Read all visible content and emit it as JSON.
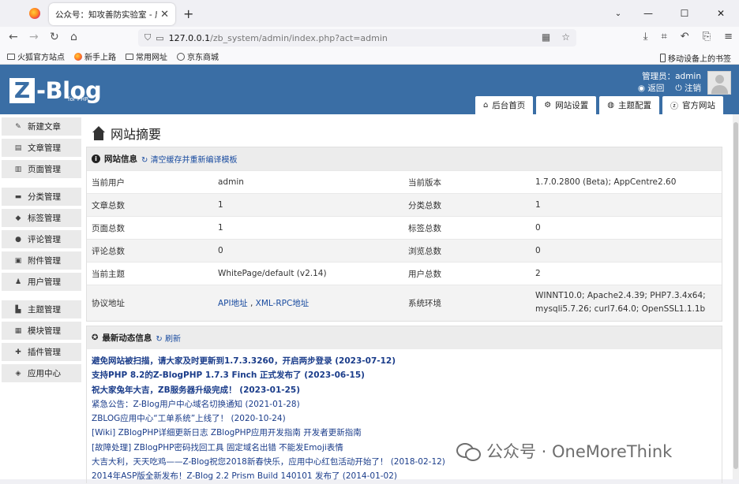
{
  "browser": {
    "tab_title": "公众号：知攻善防实验室 - 后台首页",
    "url_host": "127.0.0.1",
    "url_path": "/zb_system/admin/index.php?act=admin",
    "bookmarks": [
      "火狐官方站点",
      "新手上路",
      "常用网址",
      "京东商城"
    ],
    "mobile_bookmark": "移动设备上的书签"
  },
  "header": {
    "logo_letter": "Z",
    "logo_text": "-Blog",
    "logo_sub": "for PHP",
    "admin_label": "管理员：admin",
    "back_label": "返回",
    "logout_label": "注销",
    "tabs": [
      {
        "label": "后台首页",
        "icon": "home-icon"
      },
      {
        "label": "网站设置",
        "icon": "gear-icon"
      },
      {
        "label": "主题配置",
        "icon": "theme-icon"
      },
      {
        "label": "官方网站",
        "icon": "zblog-icon"
      }
    ]
  },
  "sidebar": {
    "items": [
      {
        "label": "新建文章",
        "icon": "edit-icon"
      },
      {
        "label": "文章管理",
        "icon": "article-icon"
      },
      {
        "label": "页面管理",
        "icon": "page-icon"
      },
      {
        "label": "分类管理",
        "icon": "folder-icon"
      },
      {
        "label": "标签管理",
        "icon": "tag-icon"
      },
      {
        "label": "评论管理",
        "icon": "comment-icon"
      },
      {
        "label": "附件管理",
        "icon": "attachment-icon"
      },
      {
        "label": "用户管理",
        "icon": "users-icon"
      },
      {
        "label": "主题管理",
        "icon": "theme-icon"
      },
      {
        "label": "模块管理",
        "icon": "module-icon"
      },
      {
        "label": "插件管理",
        "icon": "plugin-icon"
      },
      {
        "label": "应用中心",
        "icon": "app-center-icon"
      }
    ]
  },
  "main": {
    "title": "网站摘要",
    "site_info": {
      "heading": "网站信息",
      "clear_cache_link": "清空缓存并重新编译模板",
      "rows": [
        [
          "当前用户",
          "admin",
          "当前版本",
          "1.7.0.2800 (Beta); AppCentre2.60"
        ],
        [
          "文章总数",
          "1",
          "分类总数",
          "1"
        ],
        [
          "页面总数",
          "1",
          "标签总数",
          "0"
        ],
        [
          "评论总数",
          "0",
          "浏览总数",
          "0"
        ],
        [
          "当前主题",
          "WhitePage/default (v2.14)",
          "用户总数",
          "2"
        ]
      ],
      "protocol_label": "协议地址",
      "protocol_api": "API地址",
      "protocol_sep": " , ",
      "protocol_xmlrpc": "XML-RPC地址",
      "env_label": "系统环境",
      "env_line1": "WINNT10.0; Apache2.4.39; PHP7.3.4x64;",
      "env_line2": "mysqli5.7.26; curl7.64.0; OpenSSL1.1.1b"
    },
    "news": {
      "heading": "最新动态信息",
      "refresh_link": "刷新",
      "items": [
        {
          "text": "避免网站被扫描，请大家及时更新到1.7.3.3260，开启两步登录 (2023-07-12)",
          "style": "b"
        },
        {
          "text": "支持PHP 8.2的Z-BlogPHP 1.7.3 Finch 正式发布了 (2023-06-15)",
          "style": "b"
        },
        {
          "text": "祝大家兔年大吉，ZB服务器升级完成！ (2023-01-25)",
          "style": "b"
        },
        {
          "text": "紧急公告：Z-Blog用户中心域名切换通知 (2021-01-28)",
          "style": "n"
        },
        {
          "text": "ZBLOG应用中心“工单系统”上线了！ (2020-10-24)",
          "style": "n"
        },
        {
          "text": "[Wiki]   ZBlogPHP详细更新日志      ZBlogPHP应用开发指南      开发者更新指南",
          "style": "n"
        },
        {
          "text": "[故障处理]   ZBlogPHP密码找回工具      固定域名出错      不能发Emoji表情",
          "style": "n"
        },
        {
          "text": "大吉大利，天天吃鸡——Z-Blog祝您2018新春快乐，应用中心红包活动开始了！ (2018-02-12)",
          "style": "n"
        },
        {
          "text": "2014年ASP版全新发布！Z-Blog 2.2 Prism Build 140101 发布了 (2014-01-02)",
          "style": "n"
        }
      ]
    }
  },
  "watermark": "公众号 · OneMoreThink"
}
